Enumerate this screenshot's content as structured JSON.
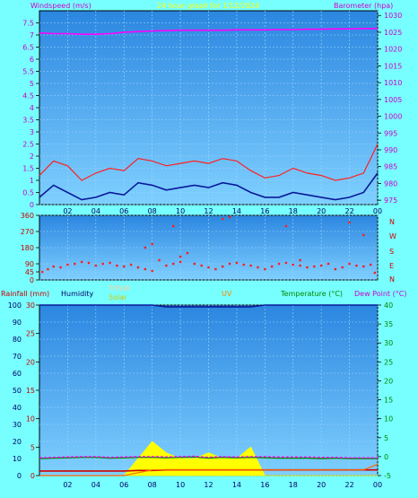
{
  "header": {
    "left_label": "Windspeed (m/s)",
    "title": "24 hour graph for  1/12/2024",
    "right_label": "Barometer (hpa)"
  },
  "wind_dir_labels": [
    "N",
    "W",
    "S",
    "E",
    "N"
  ],
  "bottom_header": {
    "rainfall": "Rainfall (mm)",
    "humidity": "Humidity",
    "thsw": "THSW",
    "solar": "Solar",
    "uv": "UV",
    "temperature": "Temperature (°C)",
    "dewpoint": "Dew Point (°C)"
  },
  "colors": {
    "background": "#77ffff",
    "panel": "#3aa0ee",
    "wind_speed": "#0a1a9a",
    "wind_gust": "#ff2020",
    "barometer": "#ff00ff",
    "wind_dir": "#ff2020",
    "humidity": "#0a1a9a",
    "solar": "#ffff00",
    "temperature": "#008800",
    "dewpoint": "#ff00ff",
    "rainfall": "#cc0000",
    "title": "#ffff00",
    "uv": "#ff8800"
  },
  "chart_data": [
    {
      "type": "line",
      "name": "wind-barometer",
      "x_ticks": [
        "02",
        "04",
        "06",
        "08",
        "10",
        "12",
        "14",
        "16",
        "18",
        "20",
        "22",
        "00"
      ],
      "ylim_left": [
        0,
        8
      ],
      "yticks_left": [
        "0",
        "0.5",
        "1",
        "1.5",
        "2",
        "2.5",
        "3",
        "3.5",
        "4",
        "4.5",
        "5",
        "5.5",
        "6",
        "6.5",
        "7",
        "7.5"
      ],
      "ylim_right": [
        973.7,
        1031.4
      ],
      "yticks_right": [
        "975",
        "980",
        "985",
        "990",
        "995",
        "1000",
        "1005",
        "1010",
        "1015",
        "1020",
        "1025",
        "1030"
      ],
      "x_hours": [
        0,
        1,
        2,
        3,
        4,
        5,
        6,
        7,
        8,
        9,
        10,
        11,
        12,
        13,
        14,
        15,
        16,
        17,
        18,
        19,
        20,
        21,
        22,
        23,
        24
      ],
      "series": [
        {
          "values": [
            0.3,
            0.8,
            0.5,
            0.2,
            0.3,
            0.5,
            0.4,
            0.9,
            0.8,
            0.6,
            0.7,
            0.8,
            0.7,
            0.9,
            0.8,
            0.5,
            0.3,
            0.3,
            0.5,
            0.4,
            0.3,
            0.2,
            0.3,
            0.5,
            1.3
          ]
        },
        {
          "values": [
            1.2,
            1.8,
            1.6,
            1.0,
            1.3,
            1.5,
            1.4,
            1.9,
            1.8,
            1.6,
            1.7,
            1.8,
            1.7,
            1.9,
            1.8,
            1.4,
            1.1,
            1.2,
            1.5,
            1.3,
            1.2,
            1.0,
            1.1,
            1.3,
            2.5
          ]
        },
        {
          "values": [
            1024.8,
            1024.6,
            1024.6,
            1024.4,
            1024.4,
            1024.6,
            1025.0,
            1025.2,
            1025.4,
            1025.5,
            1025.6,
            1025.6,
            1025.6,
            1025.6,
            1025.7,
            1025.7,
            1025.7,
            1025.8,
            1025.8,
            1025.9,
            1025.9,
            1026.0,
            1026.0,
            1026.1,
            1026.1
          ]
        }
      ]
    },
    {
      "type": "scatter",
      "name": "wind-direction",
      "x_ticks": [],
      "ylim": [
        0,
        360
      ],
      "yticks": [
        "0",
        "45",
        "90",
        "180",
        "270",
        "360"
      ],
      "series": [
        {
          "x": [
            0.2,
            0.6,
            1.0,
            1.5,
            2.0,
            2.5,
            3.0,
            3.5,
            4.0,
            4.5,
            5.0,
            5.5,
            6.0,
            6.5,
            7.0,
            7.5,
            8.0,
            8.5,
            9.0,
            9.5,
            10.0,
            10.5,
            11.0,
            11.5,
            12.0,
            12.5,
            13.0,
            13.5,
            14.0,
            14.5,
            15.0,
            15.5,
            16.0,
            16.5,
            17.0,
            17.5,
            18.0,
            18.5,
            19.0,
            19.5,
            20.0,
            20.5,
            21.0,
            21.5,
            22.0,
            22.5,
            23.0,
            23.5,
            23.8,
            8.0,
            7.5,
            9.5,
            10.0,
            13.0,
            13.5,
            17.5,
            18.5,
            22.0,
            23.0
          ],
          "y": [
            45,
            60,
            75,
            70,
            85,
            90,
            100,
            95,
            80,
            90,
            95,
            80,
            75,
            85,
            70,
            60,
            50,
            110,
            80,
            90,
            100,
            150,
            90,
            80,
            70,
            60,
            75,
            90,
            95,
            85,
            80,
            70,
            60,
            75,
            90,
            95,
            85,
            80,
            70,
            75,
            80,
            90,
            60,
            70,
            90,
            80,
            75,
            85,
            40,
            200,
            180,
            300,
            130,
            340,
            350,
            300,
            110,
            320,
            250
          ]
        }
      ]
    },
    {
      "type": "line",
      "name": "humidity-temperature",
      "x_ticks": [
        "02",
        "04",
        "06",
        "08",
        "10",
        "12",
        "14",
        "16",
        "18",
        "20",
        "22",
        "00"
      ],
      "ylim_left": [
        0,
        100
      ],
      "yticks_left": [
        "0",
        "10",
        "20",
        "30",
        "40",
        "50",
        "60",
        "70",
        "80",
        "90",
        "100"
      ],
      "ylim_mid": [
        0,
        30
      ],
      "yticks_mid": [
        "0",
        "5",
        "10",
        "15",
        "20",
        "25",
        "30"
      ],
      "ylim_right": [
        -5,
        40
      ],
      "yticks_right": [
        "-5",
        "0",
        "5",
        "10",
        "15",
        "20",
        "25",
        "30",
        "35",
        "40"
      ],
      "x_hours": [
        0,
        1,
        2,
        3,
        4,
        5,
        6,
        7,
        8,
        9,
        10,
        11,
        12,
        13,
        14,
        15,
        16,
        17,
        18,
        19,
        20,
        21,
        22,
        23,
        24
      ],
      "series": [
        {
          "values": [
            100,
            100,
            100,
            100,
            100,
            100,
            100,
            100,
            100,
            99,
            99,
            99,
            99,
            99,
            99,
            99,
            100,
            100,
            100,
            100,
            100,
            100,
            100,
            100,
            100
          ]
        },
        {
          "values": [
            0.8,
            0.8,
            0.8,
            0.8,
            0.8,
            0.8,
            0.8,
            0.9,
            0.9,
            1.0,
            1.0,
            1.0,
            1.0,
            1.0,
            1.0,
            1.0,
            1.0,
            1.0,
            1.0,
            1.0,
            1.0,
            1.0,
            1.0,
            1.0,
            1.0
          ]
        },
        {
          "values": [
            0.0,
            0.0,
            0.0,
            0.0,
            0.0,
            0.0,
            0.0,
            0.5,
            1.0,
            1.0,
            1.0,
            1.0,
            1.0,
            1.0,
            1.0,
            1.0,
            1.0,
            1.0,
            1.0,
            1.0,
            1.0,
            1.0,
            1.0,
            1.0,
            2.0
          ]
        },
        {
          "values": [
            0,
            0,
            0,
            0,
            0,
            0,
            0,
            3,
            6,
            4,
            3,
            3,
            4,
            3,
            3,
            5,
            0,
            0,
            0,
            0,
            0,
            0,
            0,
            0,
            0
          ]
        },
        {
          "values": [
            0.0,
            0.0,
            0.0,
            0.0,
            0.0,
            0.0,
            0.0,
            0.0,
            0.0,
            0.1,
            0.0,
            0.0,
            0.0,
            0.0,
            0.0,
            0.0,
            0.0,
            0.0,
            0.0,
            0.0,
            0.0,
            0.0,
            0.0,
            0.0,
            0.0
          ]
        },
        {
          "values": [
            -0.5,
            -0.4,
            -0.3,
            -0.2,
            -0.2,
            -0.4,
            -0.3,
            -0.2,
            -0.2,
            -0.3,
            -0.2,
            -0.1,
            -0.4,
            -0.2,
            -0.3,
            -0.2,
            -0.3,
            -0.4,
            -0.4,
            -0.4,
            -0.5,
            -0.4,
            -0.5,
            -0.5,
            -0.5
          ]
        },
        {
          "values": [
            -0.3,
            -0.2,
            -0.1,
            0.0,
            0.0,
            -0.2,
            -0.1,
            0.0,
            0.0,
            -0.1,
            0.0,
            0.1,
            -0.2,
            0.0,
            -0.1,
            0.0,
            0.0,
            -0.1,
            -0.1,
            -0.1,
            -0.2,
            -0.2,
            -0.3,
            -0.3,
            -0.3
          ]
        }
      ]
    }
  ]
}
